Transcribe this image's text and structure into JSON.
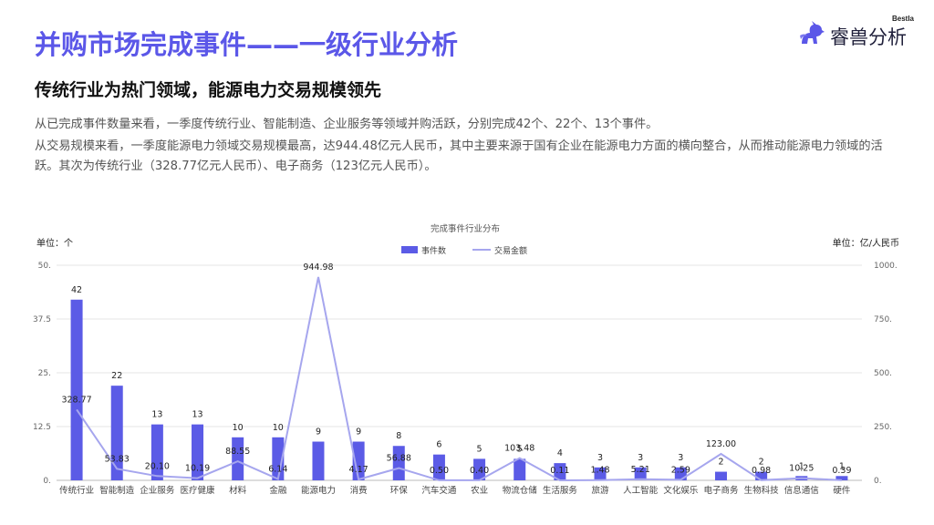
{
  "header": {
    "title": "并购市场完成事件——一级行业分析",
    "logo_small": "Bestla",
    "logo_text": "睿兽分析"
  },
  "subtitle": "传统行业为热门领域，能源电力交易规模领先",
  "paragraphs": [
    "从已完成事件数量来看，一季度传统行业、智能制造、企业服务等领域并购活跃，分别完成42个、22个、13个事件。",
    "从交易规模来看，一季度能源电力领域交易规模最高，达944.48亿元人民币，其中主要来源于国有企业在能源电力方面的横向整合，从而推动能源电力领域的活跃。其次为传统行业（328.77亿元人民币）、电子商务（123亿元人民币）。"
  ],
  "colors": {
    "accent": "#5b57e8",
    "bar": "#5b5be6",
    "line": "#a6a6ee"
  },
  "chart_data": {
    "type": "bar",
    "title": "完成事件行业分布",
    "left_unit": "单位：个",
    "right_unit": "单位：亿/人民币",
    "categories": [
      "传统行业",
      "智能制造",
      "企业服务",
      "医疗健康",
      "材料",
      "金融",
      "能源电力",
      "消费",
      "环保",
      "汽车交通",
      "农业",
      "物流仓储",
      "生活服务",
      "旅游",
      "人工智能",
      "文化娱乐",
      "电子商务",
      "生物科技",
      "信息通信",
      "硬件"
    ],
    "series": [
      {
        "name": "事件数",
        "type": "bar",
        "axis": "left",
        "values": [
          42,
          22,
          13,
          13,
          10,
          10,
          9,
          9,
          8,
          6,
          5,
          5,
          4,
          3,
          3,
          3,
          2,
          2,
          1,
          1
        ],
        "labels": [
          "42",
          "22",
          "13",
          "13",
          "10",
          "10",
          "9",
          "9",
          "8",
          "6",
          "5",
          "5",
          "4",
          "3",
          "3",
          "3",
          "2",
          "2",
          "1",
          "1"
        ]
      },
      {
        "name": "交易金额",
        "type": "line",
        "axis": "right",
        "values": [
          328.77,
          53.83,
          20.1,
          10.19,
          88.55,
          6.14,
          944.98,
          4.17,
          56.88,
          0.5,
          0.4,
          103.48,
          0.11,
          1.48,
          5.21,
          2.59,
          123.0,
          0.98,
          10.25,
          0.39
        ],
        "labels": [
          "328.77",
          "53.83",
          "20.10",
          "10.19",
          "88.55",
          "6.14",
          "944.98",
          "4.17",
          "56.88",
          "0.50",
          "0.40",
          "103.48",
          "0.11",
          "1.48",
          "5.21",
          "2.59",
          "123.00",
          "0.98",
          "10.25",
          "0.39"
        ]
      }
    ],
    "y_left": {
      "range": [
        0,
        50
      ],
      "ticks": [
        "0.",
        "12.5",
        "25.",
        "37.5",
        "50."
      ]
    },
    "y_right": {
      "range": [
        0,
        1000
      ],
      "ticks": [
        "0.",
        "250.",
        "500.",
        "750.",
        "1000."
      ]
    },
    "grid": true,
    "legend_position": "top-center"
  }
}
